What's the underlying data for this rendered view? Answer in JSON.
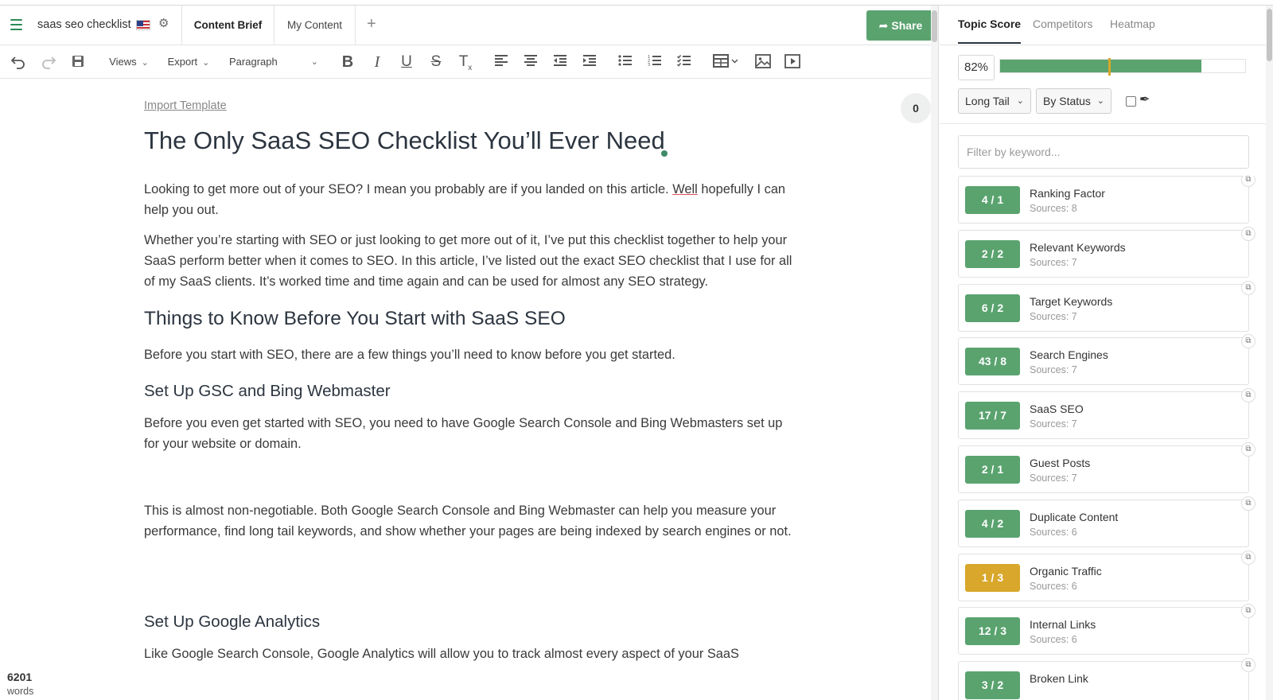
{
  "header": {
    "doc_name": "saas seo checklist",
    "tabs": [
      {
        "label": "Content Brief",
        "active": true
      },
      {
        "label": "My Content",
        "active": false
      }
    ],
    "add_tab": "+",
    "share_label": "Share",
    "share_color": "#5aa36f"
  },
  "toolbar": {
    "views_label": "Views",
    "export_label": "Export",
    "format_value": "Paragraph",
    "format_options": [
      "Paragraph"
    ]
  },
  "editor": {
    "import_template": "Import Template",
    "comment_count": "0",
    "title": "The Only SaaS SEO Checklist You’ll Ever Need",
    "p1_a": "Looking to get more out of your SEO? I mean you probably are if you landed on this article. ",
    "p1_squig": "Well",
    "p1_b": " hopefully I can help you out.",
    "p2": "Whether you’re starting with SEO or just looking to get more out of it, I’ve put this checklist together to help your SaaS perform better when it comes to SEO. In this article, I’ve listed out the exact SEO checklist that I use for all of my SaaS clients. It’s worked time and time again and can be used for almost any SEO strategy.",
    "h2_1": "Things to Know Before You Start with SaaS SEO",
    "p3": "Before you start with SEO, there are a few things you’ll need to know before you get started.",
    "h3_1": "Set Up GSC and Bing Webmaster",
    "p4": "Before you even get started with SEO, you need to have Google Search Console and Bing Webmasters set up for your website or domain.",
    "p5": "This is almost non-negotiable. Both Google Search Console and Bing Webmaster can help you measure your performance, find long tail keywords, and show whether your pages are being indexed by search engines or not.",
    "h3_2": "Set Up Google Analytics",
    "p6": "Like Google Search Console, Google Analytics will allow you to track almost every aspect of your SaaS"
  },
  "wordcount": {
    "count": "6201",
    "label": "words"
  },
  "panel": {
    "tabs": [
      {
        "label": "Topic Score",
        "active": true
      },
      {
        "label": "Competitors",
        "active": false
      },
      {
        "label": "Heatmap",
        "active": false
      }
    ],
    "score_text": "82%",
    "score_value": 82,
    "score_target": 44,
    "filter_type": "Long Tail",
    "filter_status": "By Status",
    "filter_placeholder": "Filter by keyword...",
    "keywords": [
      {
        "badge": "4 / 1",
        "name": "Ranking Factor",
        "sources": "Sources: 8",
        "status": "good"
      },
      {
        "badge": "2 / 2",
        "name": "Relevant Keywords",
        "sources": "Sources: 7",
        "status": "good"
      },
      {
        "badge": "6 / 2",
        "name": "Target Keywords",
        "sources": "Sources: 7",
        "status": "good"
      },
      {
        "badge": "43 / 8",
        "name": "Search Engines",
        "sources": "Sources: 7",
        "status": "good"
      },
      {
        "badge": "17 / 7",
        "name": "SaaS SEO",
        "sources": "Sources: 7",
        "status": "good"
      },
      {
        "badge": "2 / 1",
        "name": "Guest Posts",
        "sources": "Sources: 7",
        "status": "good"
      },
      {
        "badge": "4 / 2",
        "name": "Duplicate Content",
        "sources": "Sources: 6",
        "status": "good"
      },
      {
        "badge": "1 / 3",
        "name": "Organic Traffic",
        "sources": "Sources: 6",
        "status": "warn"
      },
      {
        "badge": "12 / 3",
        "name": "Internal Links",
        "sources": "Sources: 6",
        "status": "good"
      },
      {
        "badge": "3 / 2",
        "name": "Broken Link",
        "sources": "",
        "status": "good"
      }
    ],
    "colors": {
      "good": "#5aa36f",
      "warn": "#d8a72b"
    }
  }
}
